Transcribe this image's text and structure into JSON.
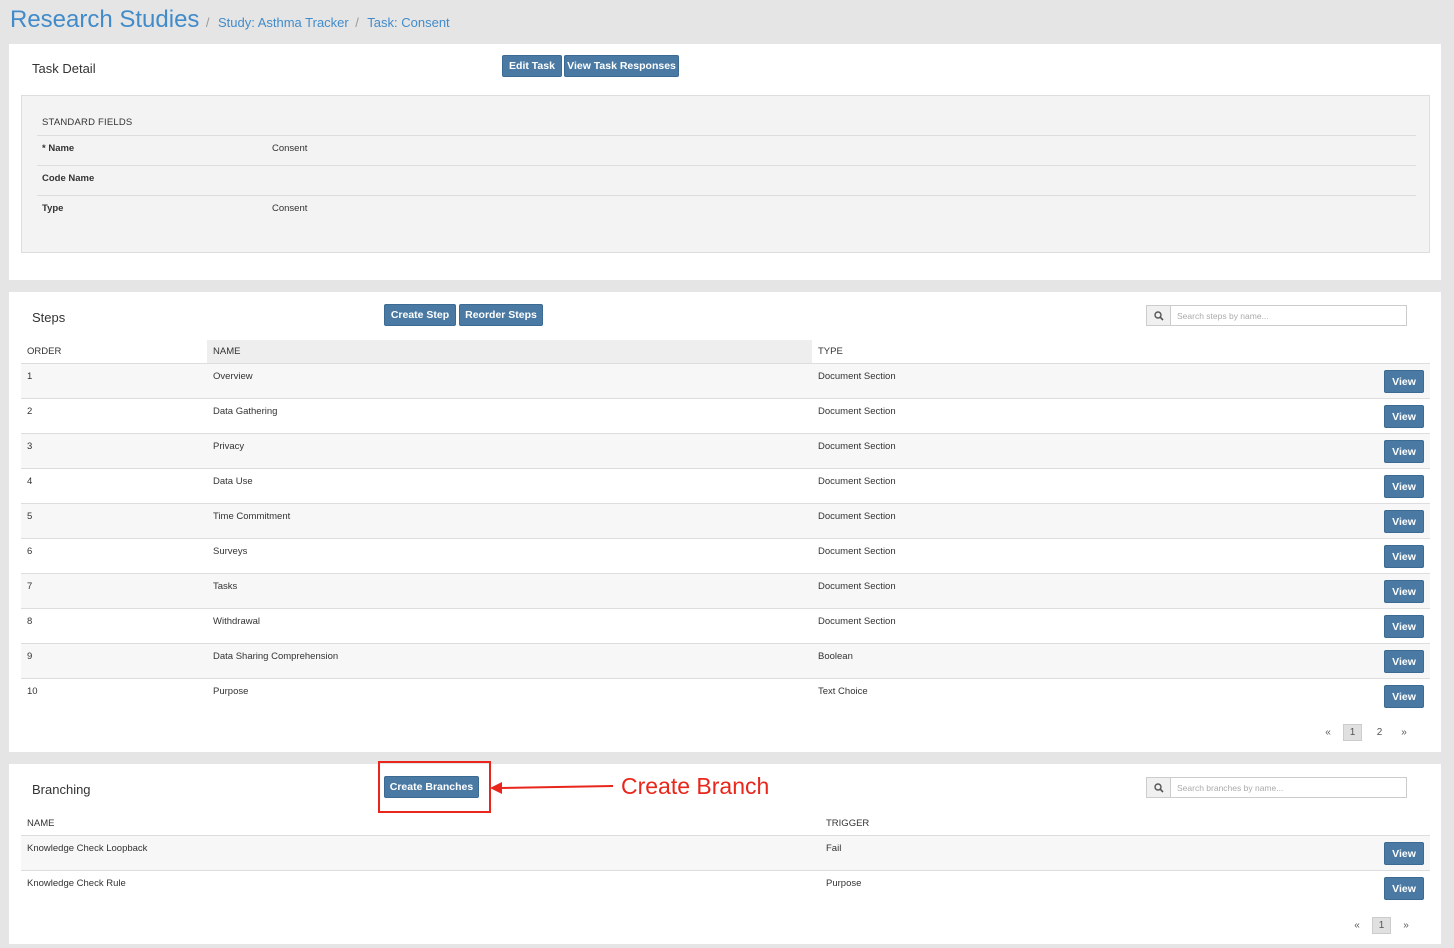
{
  "header": {
    "title": "Research Studies",
    "crumb_study": "Study: Asthma Tracker",
    "crumb_task": "Task: Consent",
    "separator": "/"
  },
  "task_detail": {
    "title": "Task Detail",
    "edit_label": "Edit Task",
    "view_responses_label": "View Task Responses",
    "section_heading": "STANDARD FIELDS",
    "fields": [
      {
        "label": "* Name",
        "value": "Consent"
      },
      {
        "label": "Code Name",
        "value": ""
      },
      {
        "label": "Type",
        "value": "Consent"
      }
    ]
  },
  "steps": {
    "title": "Steps",
    "create_label": "Create Step",
    "reorder_label": "Reorder Steps",
    "search_placeholder": "Search steps by name...",
    "columns": [
      "ORDER",
      "NAME",
      "TYPE"
    ],
    "view_label": "View",
    "rows": [
      {
        "order": "1",
        "name": "Overview",
        "type": "Document Section"
      },
      {
        "order": "2",
        "name": "Data Gathering",
        "type": "Document Section"
      },
      {
        "order": "3",
        "name": "Privacy",
        "type": "Document Section"
      },
      {
        "order": "4",
        "name": "Data Use",
        "type": "Document Section"
      },
      {
        "order": "5",
        "name": "Time Commitment",
        "type": "Document Section"
      },
      {
        "order": "6",
        "name": "Surveys",
        "type": "Document Section"
      },
      {
        "order": "7",
        "name": "Tasks",
        "type": "Document Section"
      },
      {
        "order": "8",
        "name": "Withdrawal",
        "type": "Document Section"
      },
      {
        "order": "9",
        "name": "Data Sharing Comprehension",
        "type": "Boolean"
      },
      {
        "order": "10",
        "name": "Purpose",
        "type": "Text Choice"
      }
    ],
    "pager": {
      "prev": "«",
      "pages": [
        "1",
        "2"
      ],
      "next": "»",
      "current": "1"
    }
  },
  "branching": {
    "title": "Branching",
    "create_label": "Create Branches",
    "search_placeholder": "Search branches by name...",
    "columns": [
      "NAME",
      "TRIGGER"
    ],
    "view_label": "View",
    "rows": [
      {
        "name": "Knowledge Check Loopback",
        "trigger": "Fail"
      },
      {
        "name": "Knowledge Check Rule",
        "trigger": "Purpose"
      }
    ],
    "pager": {
      "prev": "«",
      "pages": [
        "1"
      ],
      "next": "»",
      "current": "1"
    }
  },
  "annotation": {
    "label": "Create Branch",
    "color": "#e8261b"
  },
  "colors": {
    "accent": "#428bca",
    "button": "#4a7aa3",
    "background": "#e5e5e5"
  }
}
